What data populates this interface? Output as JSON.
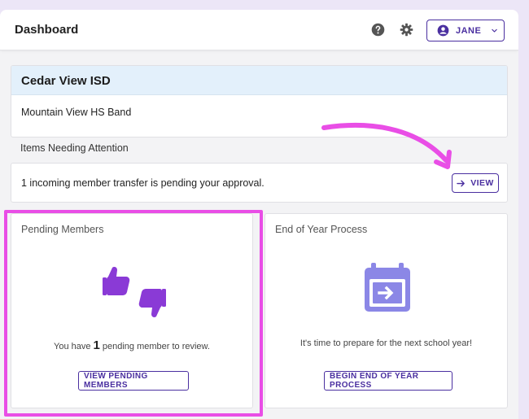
{
  "header": {
    "title": "Dashboard",
    "user_label": "JANE"
  },
  "organization": {
    "name": "Cedar View ISD",
    "program": "Mountain View HS Band"
  },
  "attention": {
    "section_label": "Items Needing Attention",
    "message": "1 incoming member transfer is pending your approval.",
    "view_label": "VIEW"
  },
  "pending_members": {
    "title": "Pending Members",
    "text_before": "You have",
    "count": "1",
    "text_after": "pending member to review.",
    "button_label": "VIEW PENDING MEMBERS"
  },
  "end_of_year": {
    "title": "End of Year Process",
    "text": "It's time to prepare for the next school year!",
    "button_label": "BEGIN END OF YEAR PROCESS"
  },
  "colors": {
    "accent": "#4a2fa0",
    "thumbs_icon": "#8a3ad6",
    "calendar_icon": "#8b87e6",
    "org_header_bg": "#e3f0fb",
    "annotation": "#e94ee6"
  },
  "icons": {
    "help": "help-circle-icon",
    "settings": "gear-icon",
    "user": "account-circle-icon",
    "menu": "chevron-down-icon",
    "view": "arrow-right-icon",
    "pending": "thumbs-up-down-icon",
    "end_of_year": "calendar-arrow-icon"
  }
}
